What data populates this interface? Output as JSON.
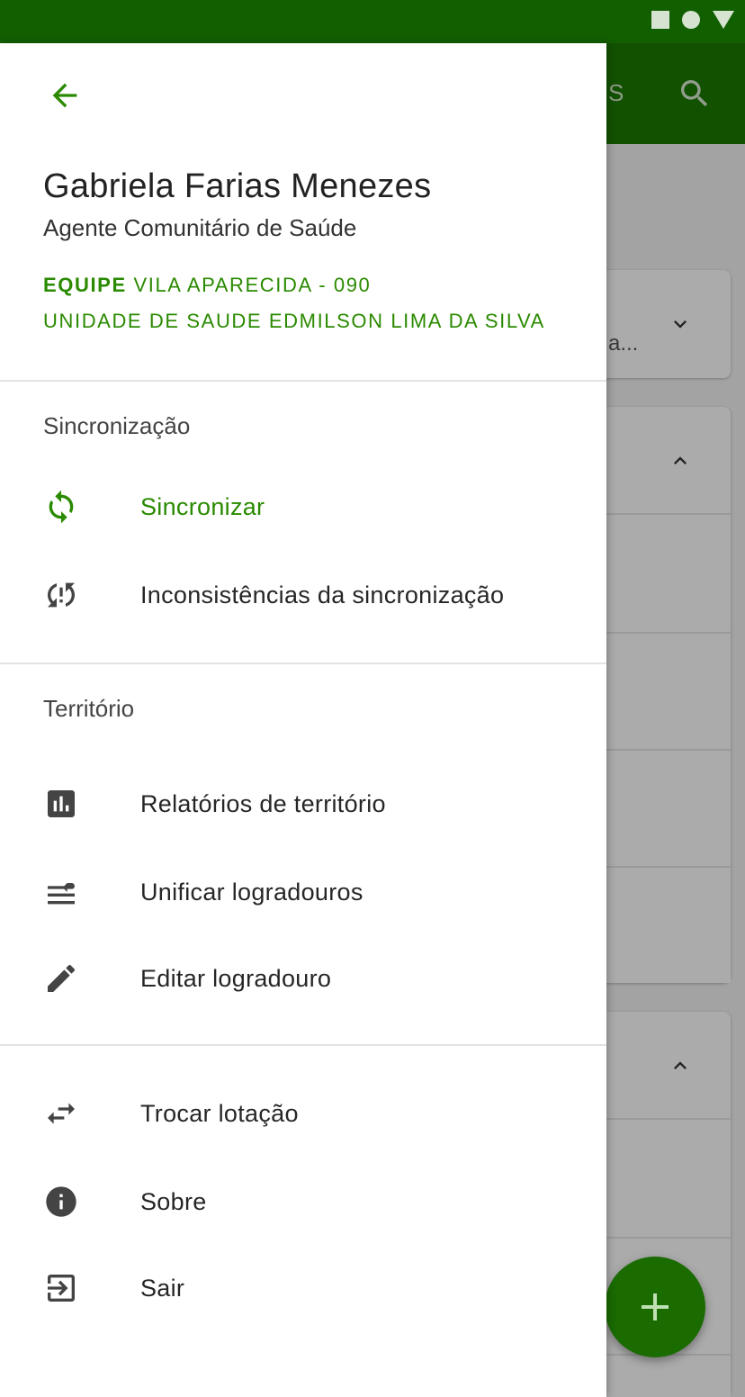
{
  "colors": {
    "primary": "#1a7a00",
    "primary_dark": "#125f00",
    "accent_text": "#2a8a00"
  },
  "background_app": {
    "appbar_fragment": "S",
    "card_fragment": "a..."
  },
  "drawer": {
    "user": {
      "name": "Gabriela Farias Menezes",
      "role": "Agente Comunitário de Saúde",
      "team_prefix": "EQUIPE",
      "team": "VILA APARECIDA - 090",
      "unit": "UNIDADE DE SAUDE EDMILSON LIMA DA SILVA"
    },
    "sections": {
      "sync_title": "Sincronização",
      "territory_title": "Território"
    },
    "items": {
      "sync": {
        "label": "Sincronizar",
        "icon": "sync-icon"
      },
      "sync_issues": {
        "label": "Inconsistências da sincronização",
        "icon": "sync-problem-icon"
      },
      "territory_reports": {
        "label": "Relatórios de território",
        "icon": "bar-chart-icon"
      },
      "merge_streets": {
        "label": "Unificar logradouros",
        "icon": "merge-list-icon"
      },
      "edit_street": {
        "label": "Editar logradouro",
        "icon": "pencil-icon"
      },
      "switch_assignment": {
        "label": "Trocar lotação",
        "icon": "swap-icon"
      },
      "about": {
        "label": "Sobre",
        "icon": "info-icon"
      },
      "logout": {
        "label": "Sair",
        "icon": "logout-icon"
      }
    }
  }
}
